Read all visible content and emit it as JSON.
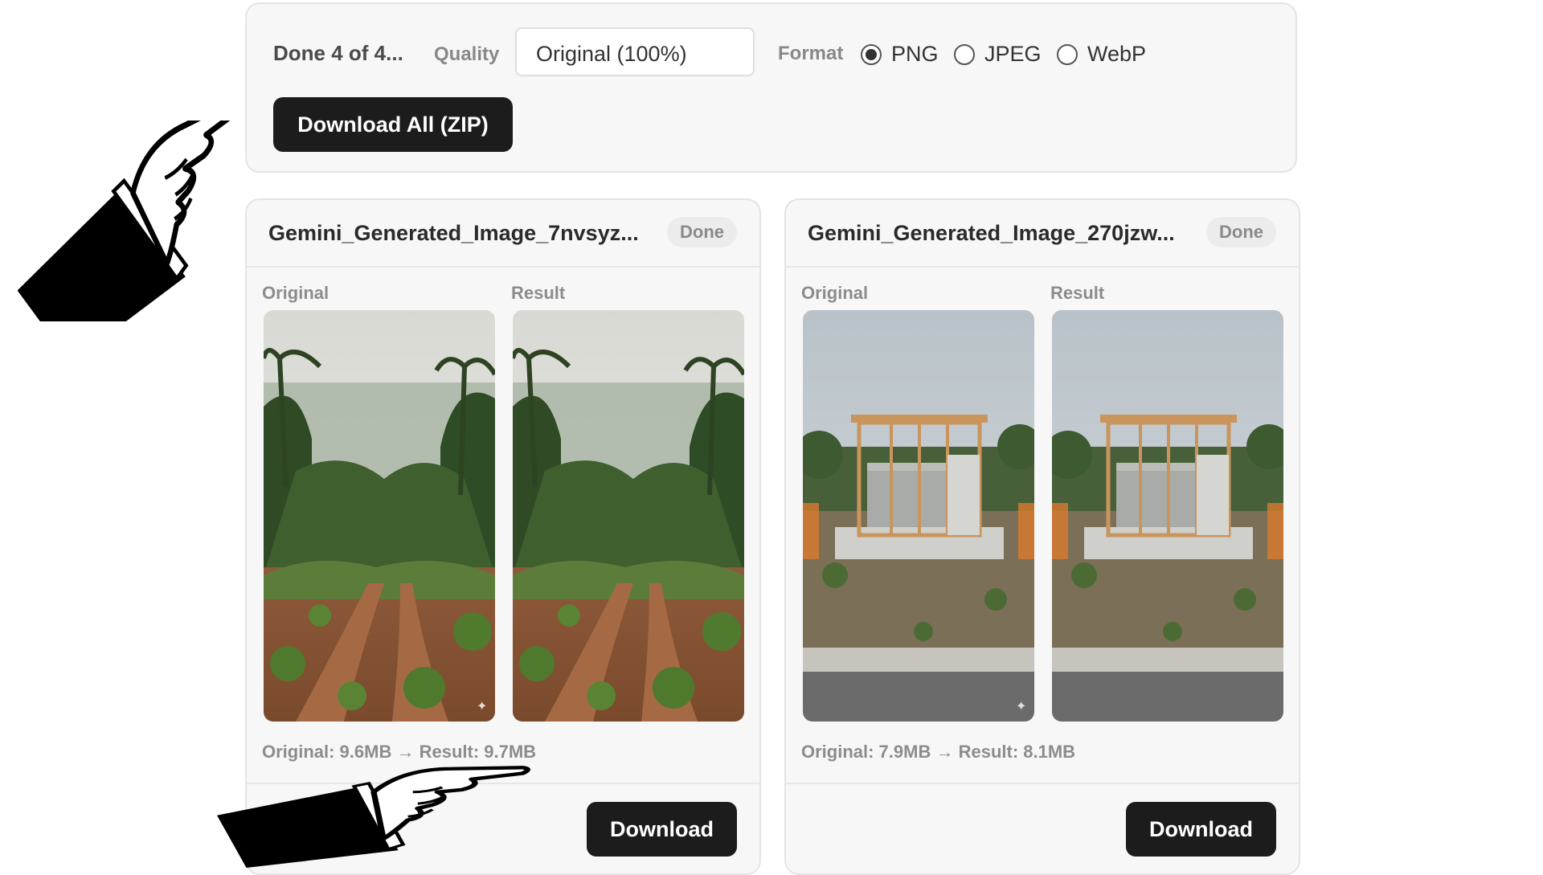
{
  "toolbar": {
    "status": "Done 4 of 4...",
    "quality_label": "Quality",
    "quality_value": "Original (100%)",
    "format_label": "Format",
    "formats": [
      {
        "label": "PNG",
        "selected": true
      },
      {
        "label": "JPEG",
        "selected": false
      },
      {
        "label": "WebP",
        "selected": false
      }
    ],
    "download_all_label": "Download All (ZIP)"
  },
  "cards": [
    {
      "file_name": "Gemini_Generated_Image_7nvsyz...",
      "status": "Done",
      "original_label": "Original",
      "result_label": "Result",
      "sizes": "Original: 9.6MB → Result: 9.7MB",
      "download_label": "Download",
      "image_subject": "jungle-dirt-path"
    },
    {
      "file_name": "Gemini_Generated_Image_270jzw...",
      "status": "Done",
      "original_label": "Original",
      "result_label": "Result",
      "sizes": "Original: 7.9MB → Result: 8.1MB",
      "download_label": "Download",
      "image_subject": "house-construction-site"
    }
  ],
  "colors": {
    "button_bg": "#1c1c1c",
    "panel_bg": "#f7f7f7",
    "muted_text": "#8c8c8c"
  }
}
